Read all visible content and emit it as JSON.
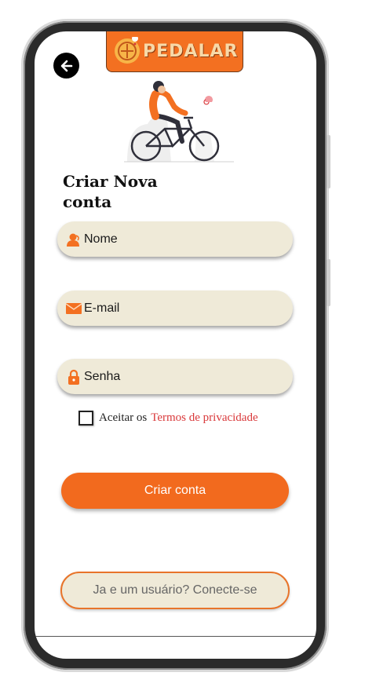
{
  "app": {
    "logo_text": "PEDALAR",
    "accent_color": "#f26a1e",
    "field_color": "#efead8"
  },
  "header": {
    "back_icon": "arrow-left-icon"
  },
  "form": {
    "title": "Criar Nova conta",
    "fields": [
      {
        "name": "name",
        "icon": "user-icon",
        "placeholder": "Nome"
      },
      {
        "name": "email",
        "icon": "envelope-icon",
        "placeholder": "E-mail"
      },
      {
        "name": "password",
        "icon": "lock-icon",
        "placeholder": "Senha"
      }
    ],
    "accept_label": "Aceitar os",
    "terms_link": "Termos de privacidade",
    "terms_checked": false,
    "submit_label": "Criar conta",
    "login_label": "Ja e um usuário? Conecte-se"
  }
}
